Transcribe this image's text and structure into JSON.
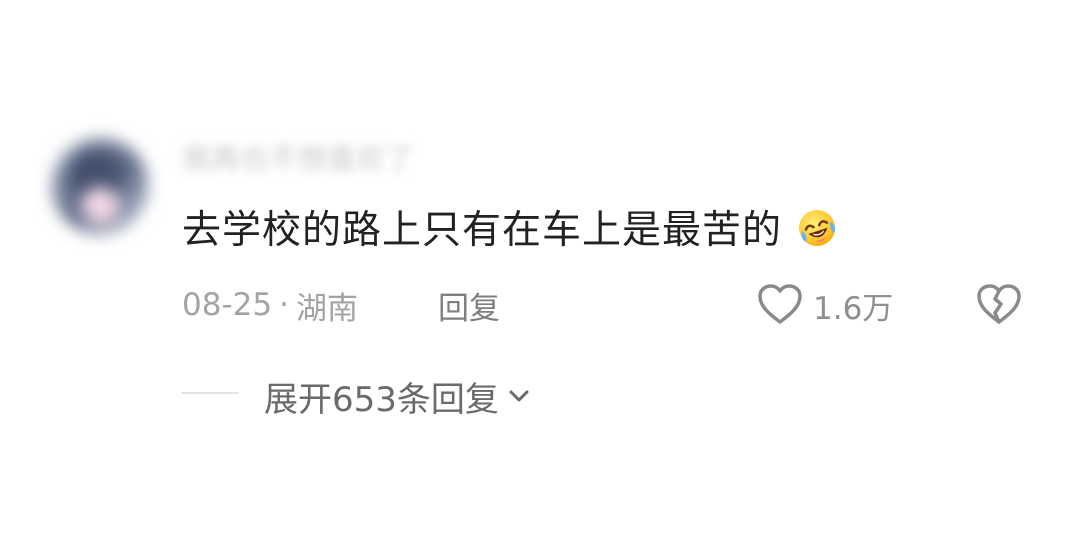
{
  "comment": {
    "username": "我再也不想喜欢了",
    "text": "去学校的路上只有在车上是最苦的",
    "emoji": "laughing-crying-emoji",
    "date": "08-25",
    "separator": "·",
    "location": "湖南",
    "reply_label": "回复",
    "like_count": "1.6万",
    "expand_label": "展开653条回复"
  },
  "colors": {
    "text": "#222222",
    "meta": "#a3a3a3",
    "action": "#7f7f7f",
    "background": "#ffffff"
  },
  "icons": {
    "like": "heart-outline-icon",
    "dislike": "broken-heart-icon",
    "expand": "chevron-down-icon"
  }
}
